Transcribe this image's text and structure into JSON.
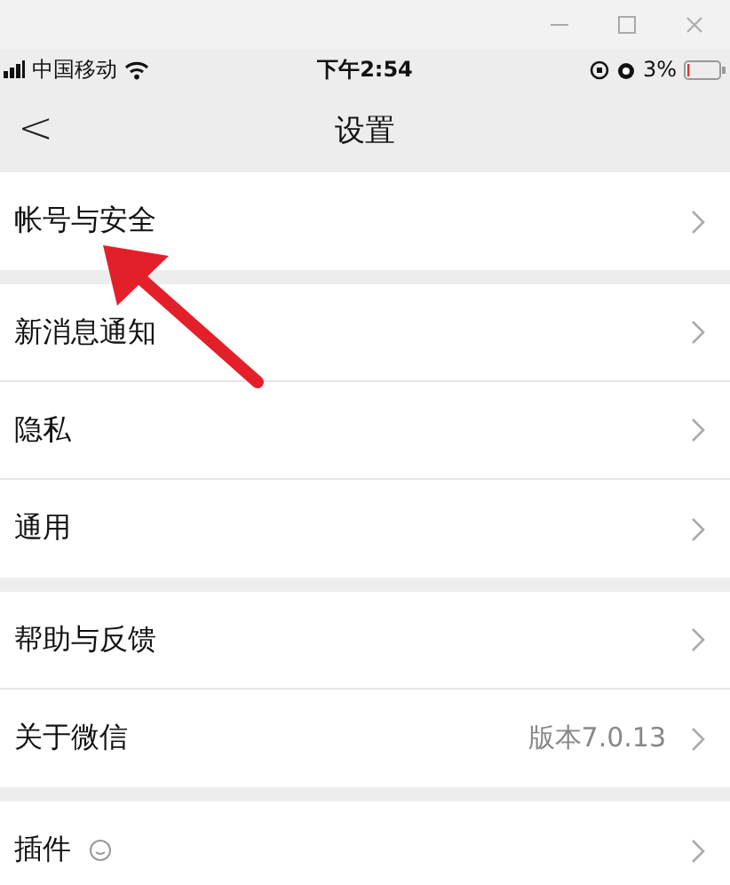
{
  "status_bar": {
    "carrier": "中国移动",
    "time": "下午2:54",
    "battery": "3%"
  },
  "nav": {
    "back": "<",
    "title": "设置"
  },
  "sections": [
    {
      "rows": [
        {
          "label": "帐号与安全"
        }
      ]
    },
    {
      "rows": [
        {
          "label": "新消息通知"
        },
        {
          "label": "隐私"
        },
        {
          "label": "通用"
        }
      ]
    },
    {
      "rows": [
        {
          "label": "帮助与反馈"
        },
        {
          "label": "关于微信",
          "value": "版本7.0.13"
        }
      ]
    },
    {
      "rows": [
        {
          "label": "插件",
          "badge": true
        }
      ]
    }
  ]
}
